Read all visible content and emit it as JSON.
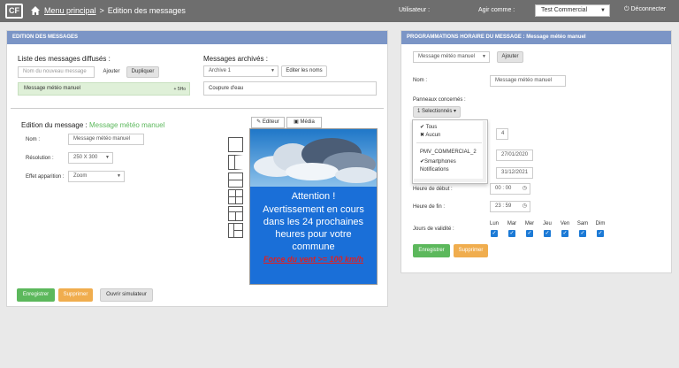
{
  "topbar": {
    "logo": "CF",
    "breadcrumb_home": "Menu principal",
    "breadcrumb_sep": ">",
    "breadcrumb_current": "Edition des messages",
    "user_label": "Utilisateur :",
    "act_as_label": "Agir comme :",
    "act_as_value": "Test Commercial",
    "logout": "Déconnecter"
  },
  "left": {
    "header": "EDITION DES MESSAGES",
    "broadcast_title": "Liste des messages diffusés :",
    "new_message_placeholder": "Nom du nouveau message",
    "add_btn": "Ajouter",
    "duplicate_btn": "Dupliquer",
    "broadcast_item": "Message météo manuel",
    "broadcast_item_badge": "+ 5Ho",
    "archived_title": "Messages archivés :",
    "archive_select": "Archive 1",
    "edit_names_btn": "Editer les noms",
    "archived_item": "Coupure d'eau",
    "edit_title_prefix": "Edition du message :",
    "edit_title_name": "Message météo manuel",
    "name_label": "Nom :",
    "name_value": "Message météo manuel",
    "resolution_label": "Résolution :",
    "resolution_value": "250 X 300",
    "effect_label": "Effet apparition :",
    "effect_value": "Zoom",
    "editor_tab": "Editeur",
    "media_tab": "Média",
    "preview_attention": "Attention !",
    "preview_text": "Avertissement en cours dans les 24 prochaines heures pour votre commune",
    "preview_red": "Force du vent >= 100 km/h",
    "save_btn": "Enregistrer",
    "delete_btn": "Supprimer",
    "simulator_btn": "Ouvrir simulateur"
  },
  "right": {
    "header": "PROGRAMMATIONS HORAIRE DU MESSAGE : Message météo manuel",
    "message_select": "Message météo manuel",
    "add_btn": "Ajouter",
    "name_label": "Nom :",
    "name_value": "Message météo manuel",
    "panels_label": "Panneaux concernés :",
    "panels_dropdown": "1 Selectionnés",
    "menu_all": "Tous",
    "menu_none": "Aucun",
    "menu_pmv": "PMV_COMMERCIAL_2",
    "menu_smartphones": "Smartphones",
    "menu_notifications": "Notifications",
    "priority_value": "4",
    "start_date": "27/01/2020",
    "end_date": "31/12/2021",
    "start_time_label": "Heure de début :",
    "start_time": "00 : 00",
    "end_time_label": "Heure de fin :",
    "end_time": "23 : 59",
    "days_label": "Jours de validité :",
    "days": [
      "Lun",
      "Mar",
      "Mer",
      "Jeu",
      "Ven",
      "Sam",
      "Dim"
    ],
    "save_btn": "Enregistrer",
    "delete_btn": "Supprimer"
  },
  "colors": {
    "panel_header": "#7b95c6",
    "topbar": "#6e6e6e",
    "green": "#5cb85c",
    "orange": "#f0ad4e",
    "checkbox": "#1c7ad6"
  }
}
